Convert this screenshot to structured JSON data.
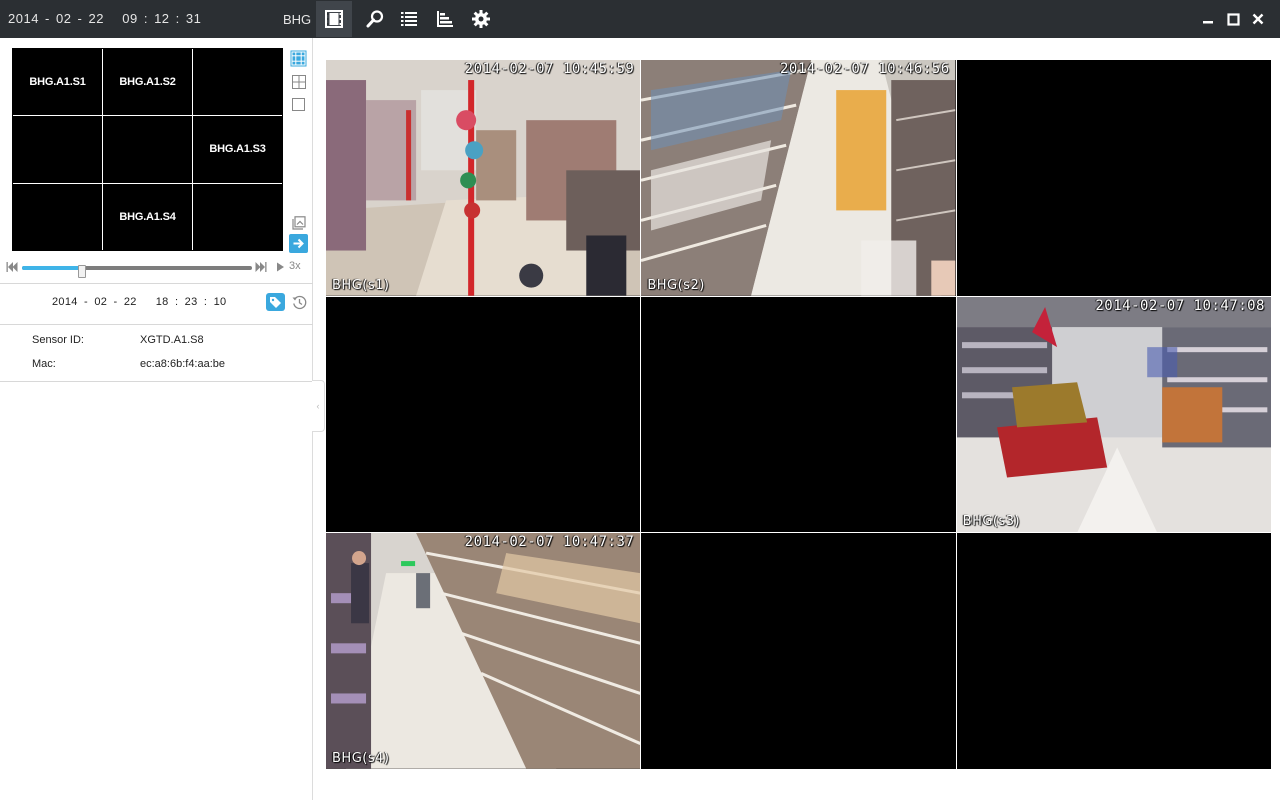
{
  "topbar": {
    "clock": "2014 - 02 - 22   09 : 12 : 31",
    "site": "BHG",
    "tools": [
      "film-icon",
      "search-icon",
      "list-icon",
      "bar-chart-icon",
      "gear-icon"
    ]
  },
  "sidebar": {
    "mini_grid": [
      "BHG.A1.S1",
      "BHG.A1.S2",
      "",
      "",
      "",
      "BHG.A1.S3",
      "",
      "BHG.A1.S4",
      ""
    ],
    "speed": "3x",
    "progress": 0.26,
    "playback_datetime": "2014 - 02 - 22   18 : 23 : 10",
    "sensor_label": "Sensor ID:",
    "sensor_value": "XGTD.A1.S8",
    "mac_label": "Mac:",
    "mac_value": "ec:a8:6b:f4:aa:be"
  },
  "cameras": [
    {
      "label": "BHG(s1)",
      "timestamp": "2014-02-07 10:45:59"
    },
    {
      "label": "BHG(s2)",
      "timestamp": "2014-02-07 10:46:56"
    },
    {
      "label": "",
      "timestamp": ""
    },
    {
      "label": "",
      "timestamp": ""
    },
    {
      "label": "",
      "timestamp": ""
    },
    {
      "label": "BHG(s3)",
      "timestamp": "2014-02-07 10:47:08"
    },
    {
      "label": "BHG(s4)",
      "timestamp": "2014-02-07 10:47:37"
    },
    {
      "label": "",
      "timestamp": ""
    },
    {
      "label": "",
      "timestamp": ""
    }
  ],
  "colors": {
    "accent": "#3aa8de",
    "topbar": "#2b2f33"
  }
}
